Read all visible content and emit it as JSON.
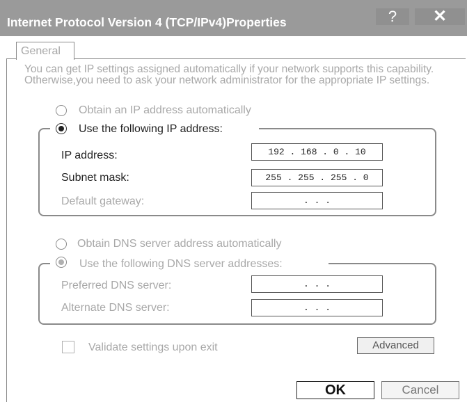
{
  "window": {
    "title": "Internet Protocol Version 4 (TCP/IPv4)Properties",
    "help_label": "?",
    "close_label": "✕"
  },
  "tab": {
    "label": "General"
  },
  "description": "You can get IP settings assigned automatically if your network supports this capability. Otherwise,you need to ask your network administrator for the appropriate IP settings.",
  "ip_section": {
    "obtain_auto_label": "Obtain an IP address automatically",
    "use_following_label": "Use the following IP address:",
    "selected": "use_following",
    "fields": [
      {
        "label": "IP address:",
        "value": "192 . 168 .  0  . 10"
      },
      {
        "label": "Subnet mask:",
        "value": "255 . 255 . 255 .  0"
      },
      {
        "label": "Default gateway:",
        "value": ".       .       ."
      }
    ]
  },
  "dns_section": {
    "obtain_auto_label": "Obtain DNS  server address automatically",
    "use_following_label": "Use the following DNS server addresses:",
    "fields": [
      {
        "label": "Preferred DNS server:",
        "value": ".       .       ."
      },
      {
        "label": "Alternate DNS server:",
        "value": ".       .       ."
      }
    ]
  },
  "validate_label": "Validate settings upon exit",
  "buttons": {
    "advanced": "Advanced",
    "ok": "OK",
    "cancel": "Cancel"
  }
}
